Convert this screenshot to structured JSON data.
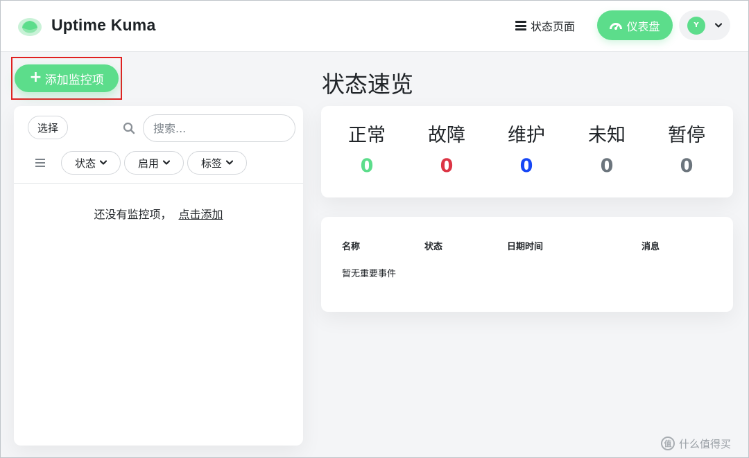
{
  "header": {
    "app_title": "Uptime Kuma",
    "status_page_label": "状态页面",
    "dashboard_label": "仪表盘",
    "avatar_letter": "Y"
  },
  "sidebar": {
    "add_monitor_label": "添加监控项",
    "select_label": "选择",
    "search_placeholder": "搜索...",
    "filters": [
      {
        "label": "状态"
      },
      {
        "label": "启用"
      },
      {
        "label": "标签"
      }
    ],
    "empty_text": "还没有监控项，",
    "empty_link": "点击添加"
  },
  "main": {
    "title": "状态速览",
    "stats": [
      {
        "label": "正常",
        "value": "0",
        "color": "#5cdd8b"
      },
      {
        "label": "故障",
        "value": "0",
        "color": "#dc3545"
      },
      {
        "label": "维护",
        "value": "0",
        "color": "#1747f5"
      },
      {
        "label": "未知",
        "value": "0",
        "color": "#6c757d"
      },
      {
        "label": "暂停",
        "value": "0",
        "color": "#6c757d"
      }
    ],
    "events_table": {
      "columns": [
        "名称",
        "状态",
        "日期时间",
        "消息"
      ],
      "empty_text": "暂无重要事件"
    }
  },
  "colors": {
    "accent": "#5cdd8b",
    "highlight": "#e02020"
  },
  "watermark": {
    "text": "什么值得买",
    "icon_glyph": "值"
  }
}
